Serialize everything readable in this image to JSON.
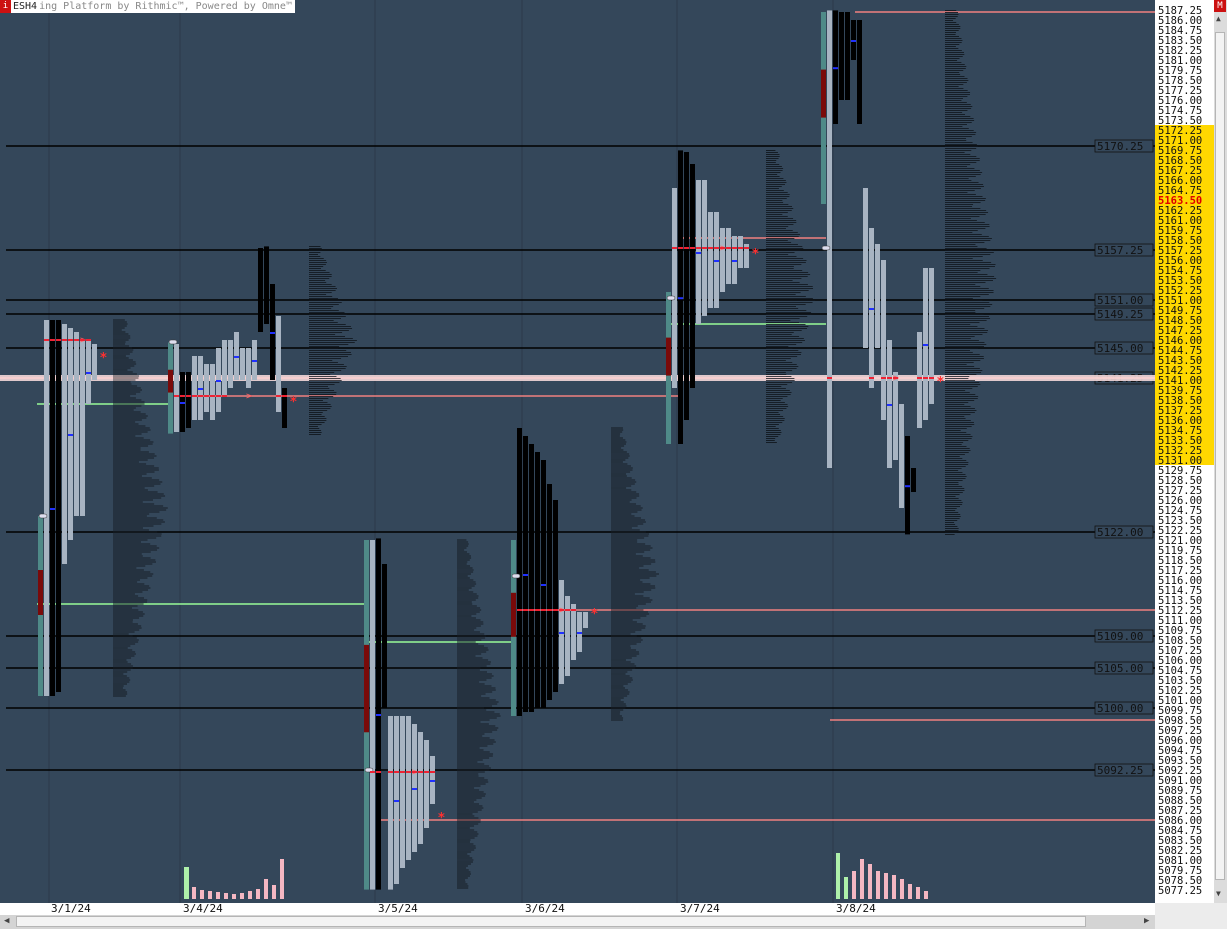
{
  "header": {
    "info_icon": "i",
    "symbol": "ESH4",
    "title": "ing Platform by Rithmic™, Powered by Omne™",
    "m_button": "M"
  },
  "colors": {
    "background": "#34475a",
    "level_line": "#000000",
    "poc_line": "#f08080",
    "ib_line": "#98fb98",
    "bar": "#a8b4c2",
    "bar_dark": "#000000",
    "ib_bar_teal": "#4f8a88",
    "ib_bar_red": "#7a0a0a",
    "price_highlight": "#ffd800",
    "last_price_text": "#dd0000"
  },
  "chart_data": {
    "type": "market-profile",
    "title": "",
    "y_axis": {
      "min": 5077.25,
      "max": 5187.25,
      "tick_step": 1.25,
      "value_area_highlight": [
        5131.0,
        5172.25
      ],
      "last_price": "5163.50"
    },
    "x_axis": {
      "labels": [
        "3/1/24",
        "3/4/24",
        "3/5/24",
        "3/6/24",
        "3/7/24",
        "3/8/24"
      ]
    },
    "level_labels": [
      {
        "price": 5170.25,
        "label": "5170.25"
      },
      {
        "price": 5157.25,
        "label": "5157.25"
      },
      {
        "price": 5151.0,
        "label": "5151.00"
      },
      {
        "price": 5149.25,
        "label": "5149.25"
      },
      {
        "price": 5145.0,
        "label": "5145.00"
      },
      {
        "price": 5141.25,
        "label": "5141.25"
      },
      {
        "price": 5122.0,
        "label": "5122.00"
      },
      {
        "price": 5109.0,
        "label": "5109.00"
      },
      {
        "price": 5105.0,
        "label": "5105.00"
      },
      {
        "price": 5100.0,
        "label": "5100.00"
      },
      {
        "price": 5092.25,
        "label": "5092.25"
      }
    ],
    "poc_lines": [
      5187.0,
      5158.75,
      5112.25,
      5139.0,
      5086.0,
      5098.5,
      5141.25
    ],
    "ib_lines": [
      5138.0,
      5113.0,
      5108.25,
      5148.0
    ],
    "sessions": [
      {
        "date": "3/1/24",
        "high": 5148.5,
        "low": 5101.5,
        "open": 5124.0,
        "poc": 5146.0,
        "close": 5144.0
      },
      {
        "date": "3/4/24",
        "high": 5157.75,
        "low": 5134.25,
        "open": 5145.75,
        "poc": 5139.0,
        "close": 5138.5
      },
      {
        "date": "3/5/24",
        "high": 5121.25,
        "low": 5077.25,
        "open": 5092.25,
        "poc": 5092.0,
        "close": 5086.5
      },
      {
        "date": "3/6/24",
        "high": 5135.0,
        "low": 5098.5,
        "open": 5116.5,
        "poc": 5112.25,
        "close": 5112.0
      },
      {
        "date": "3/7/24",
        "high": 5169.75,
        "low": 5133.0,
        "open": 5151.25,
        "poc": 5157.5,
        "close": 5157.0
      },
      {
        "date": "3/8/24",
        "high": 5187.25,
        "low": 5121.75,
        "open": 5157.5,
        "poc": 5141.25,
        "close": 5141.0
      }
    ]
  }
}
